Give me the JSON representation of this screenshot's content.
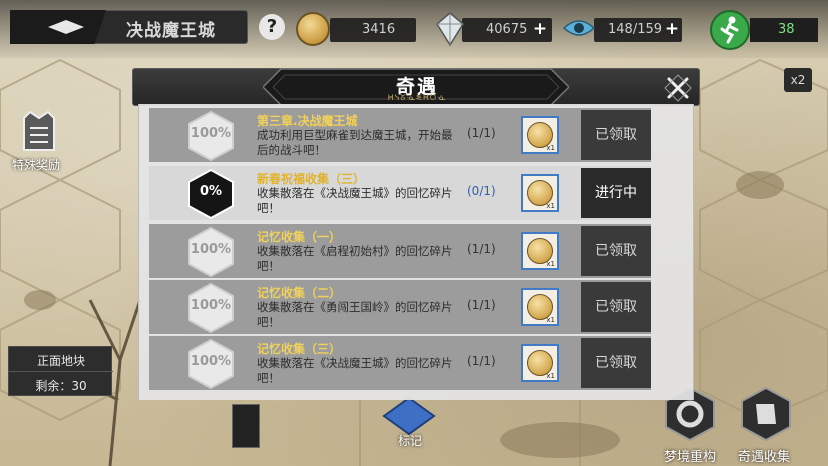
{
  "header": {
    "stage_title": "决战魔王城",
    "help_label": "?",
    "gold": "3416",
    "gems": "40675",
    "vision": "148/159",
    "energy": "38",
    "speed": "x2"
  },
  "left": {
    "reward_label": "特殊奖励",
    "front_title": "正面地块",
    "front_remain": "剩余：30"
  },
  "bottom": {
    "mark_label": "标记",
    "dream_label": "梦境重构",
    "collect_label": "奇遇收集"
  },
  "modal": {
    "title": "奇遇",
    "decoration": "ᕼᓭᘜᓍᓬᕼᘮᓍ"
  },
  "quests": [
    {
      "percent": "100%",
      "title": "第三章.决战魔王城",
      "desc": "成功利用巨型麻雀到达魔王城，开始最后的战斗吧！",
      "progress": "(1/1)",
      "status": "已领取",
      "state": "done"
    },
    {
      "percent": "0%",
      "title": "新春祝福收集（三）",
      "desc": "收集散落在《决战魔王城》的回忆碎片吧！",
      "progress": "(0/1)",
      "status": "进行中",
      "state": "active"
    },
    {
      "percent": "100%",
      "title": "记忆收集（一）",
      "desc": "收集散落在《启程初始村》的回忆碎片吧！",
      "progress": "(1/1)",
      "status": "已领取",
      "state": "done"
    },
    {
      "percent": "100%",
      "title": "记忆收集（二）",
      "desc": "收集散落在《勇闯王国岭》的回忆碎片吧！",
      "progress": "(1/1)",
      "status": "已领取",
      "state": "done"
    },
    {
      "percent": "100%",
      "title": "记忆收集（三）",
      "desc": "收集散落在《决战魔王城》的回忆碎片吧！",
      "progress": "(1/1)",
      "status": "已领取",
      "state": "done"
    }
  ],
  "reward_count": "x1",
  "colors": {
    "accent_yellow": "#f1d15a",
    "progress_blue": "#2f5fb3",
    "energy_green": "#3aa94a"
  }
}
